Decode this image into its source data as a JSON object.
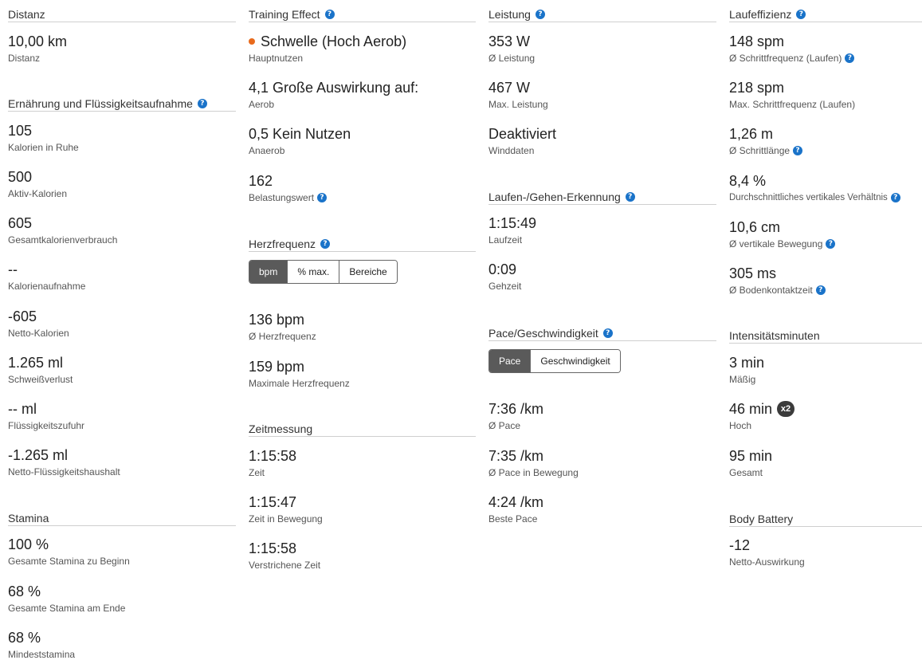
{
  "col1": {
    "distanz": {
      "title": "Distanz",
      "stats": [
        {
          "value": "10,00 km",
          "label": "Distanz"
        }
      ]
    },
    "ernaehrung": {
      "title": "Ernährung und Flüssigkeitsaufnahme",
      "stats": [
        {
          "value": "105",
          "label": "Kalorien in Ruhe"
        },
        {
          "value": "500",
          "label": "Aktiv-Kalorien"
        },
        {
          "value": "605",
          "label": "Gesamtkalorienverbrauch"
        },
        {
          "value": "--",
          "label": "Kalorienaufnahme"
        },
        {
          "value": "-605",
          "label": "Netto-Kalorien"
        },
        {
          "value": "1.265 ml",
          "label": "Schweißverlust"
        },
        {
          "value": "-- ml",
          "label": "Flüssigkeitszufuhr"
        },
        {
          "value": "-1.265 ml",
          "label": "Netto-Flüssigkeitshaushalt"
        }
      ]
    },
    "stamina": {
      "title": "Stamina",
      "stats": [
        {
          "value": "100 %",
          "label": "Gesamte Stamina zu Beginn"
        },
        {
          "value": "68 %",
          "label": "Gesamte Stamina am Ende"
        },
        {
          "value": "68 %",
          "label": "Mindeststamina"
        }
      ]
    }
  },
  "col2": {
    "training": {
      "title": "Training Effect",
      "stats": [
        {
          "value": "Schwelle (Hoch Aerob)",
          "label": "Hauptnutzen"
        },
        {
          "value": "4,1 Große Auswirkung auf:",
          "label": "Aerob"
        },
        {
          "value": "0,5 Kein Nutzen",
          "label": "Anaerob"
        },
        {
          "value": "162",
          "label": "Belastungswert"
        }
      ]
    },
    "herz": {
      "title": "Herzfrequenz",
      "toggle": [
        "bpm",
        "% max.",
        "Bereiche"
      ],
      "stats": [
        {
          "value": "136 bpm",
          "label": "Ø Herzfrequenz"
        },
        {
          "value": "159 bpm",
          "label": "Maximale Herzfrequenz"
        }
      ]
    },
    "zeit": {
      "title": "Zeitmessung",
      "stats": [
        {
          "value": "1:15:58",
          "label": "Zeit"
        },
        {
          "value": "1:15:47",
          "label": "Zeit in Bewegung"
        },
        {
          "value": "1:15:58",
          "label": "Verstrichene Zeit"
        }
      ]
    }
  },
  "col3": {
    "leistung": {
      "title": "Leistung",
      "stats": [
        {
          "value": "353 W",
          "label": "Ø Leistung"
        },
        {
          "value": "467 W",
          "label": "Max. Leistung"
        },
        {
          "value": "Deaktiviert",
          "label": "Winddaten"
        }
      ]
    },
    "laufen": {
      "title": "Laufen-/Gehen-Erkennung",
      "stats": [
        {
          "value": "1:15:49",
          "label": "Laufzeit"
        },
        {
          "value": "0:09",
          "label": "Gehzeit"
        }
      ]
    },
    "pace": {
      "title": "Pace/Geschwindigkeit",
      "toggle": [
        "Pace",
        "Geschwindigkeit"
      ],
      "stats": [
        {
          "value": "7:36 /km",
          "label": "Ø Pace"
        },
        {
          "value": "7:35 /km",
          "label": "Ø Pace in Bewegung"
        },
        {
          "value": "4:24 /km",
          "label": "Beste Pace"
        }
      ]
    }
  },
  "col4": {
    "lauf": {
      "title": "Laufeffizienz",
      "stats": [
        {
          "value": "148 spm",
          "label": "Ø Schrittfrequenz (Laufen)"
        },
        {
          "value": "218 spm",
          "label": "Max. Schrittfrequenz (Laufen)"
        },
        {
          "value": "1,26 m",
          "label": "Ø Schrittlänge"
        },
        {
          "value": "8,4 %",
          "label": "Durchschnittliches vertikales Verhältnis"
        },
        {
          "value": "10,6 cm",
          "label": "Ø vertikale Bewegung"
        },
        {
          "value": "305 ms",
          "label": "Ø Bodenkontaktzeit"
        }
      ]
    },
    "intens": {
      "title": "Intensitätsminuten",
      "badge": "x2",
      "stats": [
        {
          "value": "3 min",
          "label": "Mäßig"
        },
        {
          "value": "46 min",
          "label": "Hoch"
        },
        {
          "value": "95 min",
          "label": "Gesamt"
        }
      ]
    },
    "body": {
      "title": "Body Battery",
      "stats": [
        {
          "value": "-12",
          "label": "Netto-Auswirkung"
        }
      ]
    }
  },
  "icons": {
    "help": "?",
    "help_name": "help-icon"
  },
  "colors": {
    "accent_dot": "#e86a1c",
    "help_blue": "#1a73c9",
    "toggle_active": "#5a5a5a"
  }
}
